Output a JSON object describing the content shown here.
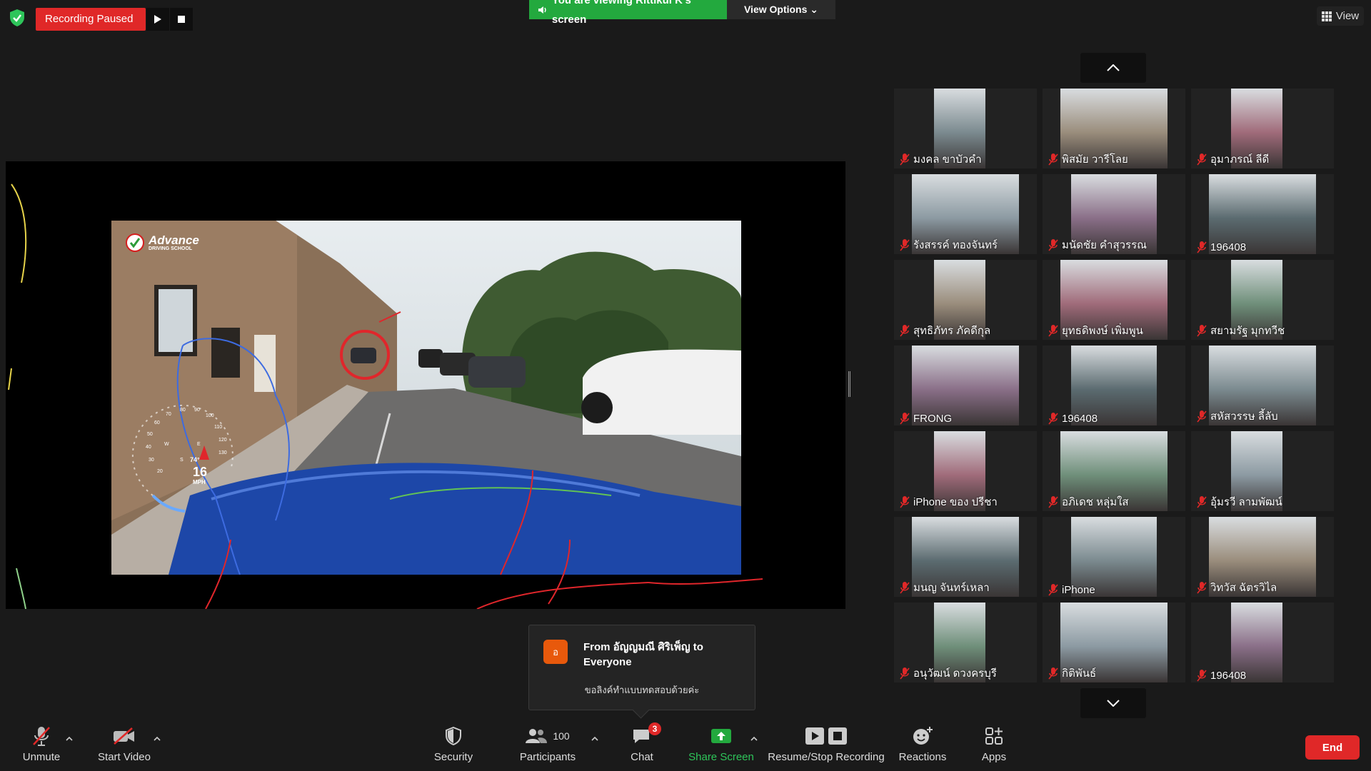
{
  "top_bar": {
    "recording_status": "Recording Paused",
    "viewing_banner": "You are viewing Rittikul K's screen",
    "view_options": "View Options",
    "view": "View"
  },
  "shared_screen": {
    "logo_title": "Advance",
    "logo_subtitle": "DRIVING SCHOOL",
    "speed_value": "16",
    "speed_unit": "MPH",
    "temperature": "74°",
    "compass": [
      "W",
      "S",
      "E"
    ],
    "gauge_ticks": [
      "20",
      "30",
      "40",
      "50",
      "60",
      "70",
      "80",
      "90",
      "100",
      "110",
      "120",
      "130"
    ]
  },
  "participants": [
    {
      "name": "มงคล ขาบัวคำ"
    },
    {
      "name": "พิสมัย วารีโลย"
    },
    {
      "name": "อุมาภรณ์ ลีดี"
    },
    {
      "name": "รังสรรค์ ทองจันทร์"
    },
    {
      "name": "มนัดชัย คำสุวรรณ"
    },
    {
      "name": "196408"
    },
    {
      "name": "สุทธิภัทร ภัคดีกุล"
    },
    {
      "name": "ยุทธดิพงษ์ เพิ่มพูน"
    },
    {
      "name": "สยามรัฐ มุกทวีช"
    },
    {
      "name": "FRONG"
    },
    {
      "name": "196408"
    },
    {
      "name": "สหัสวรรษ ลี้ลับ"
    },
    {
      "name": "iPhone ของ ปรีชา"
    },
    {
      "name": "อภิเดช หลุ่มใส"
    },
    {
      "name": "อุ้มรวี ลามพัฒน์"
    },
    {
      "name": "มนญ จันทร์เหลา"
    },
    {
      "name": "iPhone"
    },
    {
      "name": "วิทวัส ฉัตรวิไล"
    },
    {
      "name": "อนุวัฒน์ ดวงครบุรี"
    },
    {
      "name": "กิติพันธ์"
    },
    {
      "name": "196408"
    }
  ],
  "chat_notification": {
    "avatar_letter": "อ",
    "from": "From อัญญมณี ศิริเพ็ญ to Everyone",
    "message": "ขอลิงค์ทำแบบทดสอบด้วยค่ะ"
  },
  "toolbar": {
    "unmute": "Unmute",
    "start_video": "Start Video",
    "security": "Security",
    "participants": "Participants",
    "participants_count": "100",
    "chat": "Chat",
    "chat_badge": "3",
    "share_screen": "Share Screen",
    "recording": "Resume/Stop Recording",
    "reactions": "Reactions",
    "apps": "Apps",
    "end": "End"
  },
  "colors": {
    "record_red": "#e02828",
    "share_green": "#23a93e",
    "security_green": "#2ec55a"
  }
}
